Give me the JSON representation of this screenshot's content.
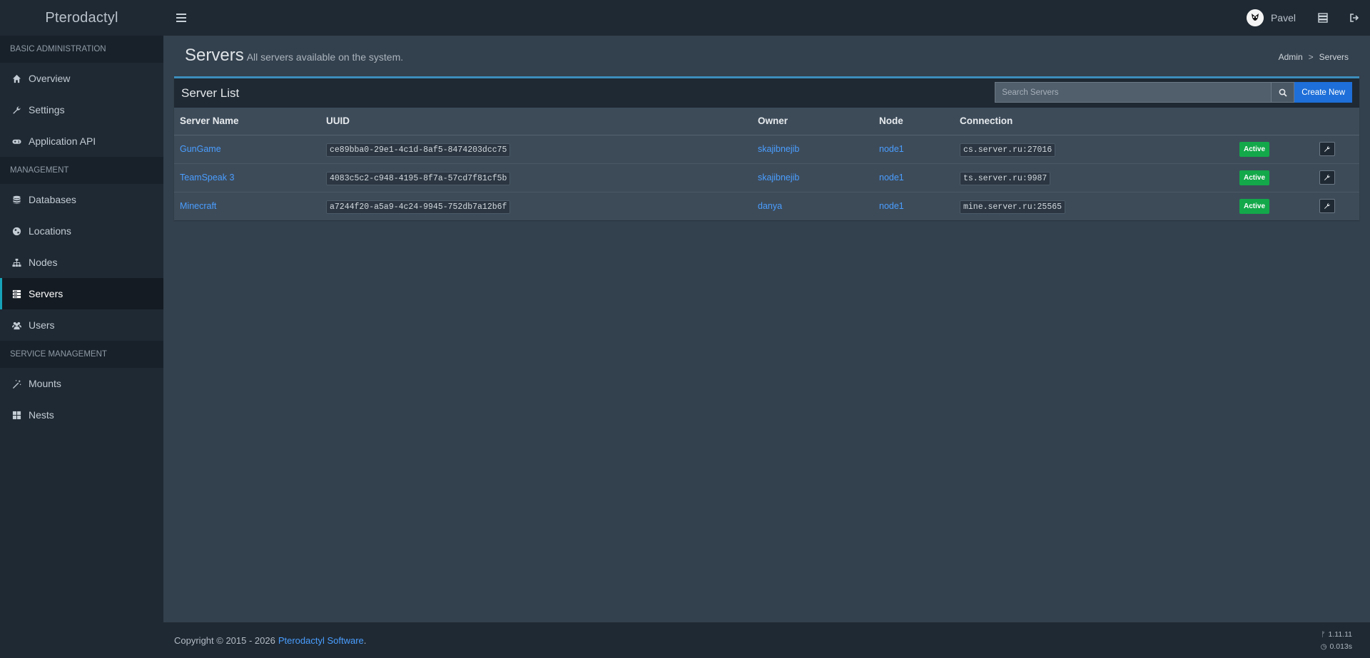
{
  "app": {
    "brand": "Pterodactyl"
  },
  "topbar": {
    "user_name": "Pavel"
  },
  "sidebar": {
    "sections": [
      {
        "header": "Basic Administration",
        "items": [
          {
            "label": "Overview",
            "icon": "home-icon"
          },
          {
            "label": "Settings",
            "icon": "wrench-icon"
          },
          {
            "label": "Application API",
            "icon": "gamepad-icon"
          }
        ]
      },
      {
        "header": "Management",
        "items": [
          {
            "label": "Databases",
            "icon": "database-icon"
          },
          {
            "label": "Locations",
            "icon": "globe-icon"
          },
          {
            "label": "Nodes",
            "icon": "sitemap-icon"
          },
          {
            "label": "Servers",
            "icon": "server-icon",
            "active": true
          },
          {
            "label": "Users",
            "icon": "users-icon"
          }
        ]
      },
      {
        "header": "Service Management",
        "items": [
          {
            "label": "Mounts",
            "icon": "magic-icon"
          },
          {
            "label": "Nests",
            "icon": "th-large-icon"
          }
        ]
      }
    ]
  },
  "page": {
    "title": "Servers",
    "subtitle": "All servers available on the system.",
    "breadcrumb": [
      "Admin",
      "Servers"
    ]
  },
  "server_list": {
    "title": "Server List",
    "search_placeholder": "Search Servers",
    "create_label": "Create New",
    "columns": [
      "Server Name",
      "UUID",
      "Owner",
      "Node",
      "Connection"
    ],
    "rows": [
      {
        "name": "GunGame",
        "uuid": "ce89bba0-29e1-4c1d-8af5-8474203dcc75",
        "owner": "skajibnejib",
        "node": "node1",
        "connection": "cs.server.ru:27016",
        "status": "Active"
      },
      {
        "name": "TeamSpeak 3",
        "uuid": "4083c5c2-c948-4195-8f7a-57cd7f81cf5b",
        "owner": "skajibnejib",
        "node": "node1",
        "connection": "ts.server.ru:9987",
        "status": "Active"
      },
      {
        "name": "Minecraft",
        "uuid": "a7244f20-a5a9-4c24-9945-752db7a12b6f",
        "owner": "danya",
        "node": "node1",
        "connection": "mine.server.ru:25565",
        "status": "Active"
      }
    ]
  },
  "footer": {
    "copyright": "Copyright © 2015 - 2026",
    "company": "Pterodactyl Software",
    "suffix": ".",
    "version": "1.11.11",
    "time": "0.013s"
  },
  "colors": {
    "accent": "#3c8dbc",
    "primary_button": "#1e6fd9",
    "status_active": "#13a84a",
    "active_marker": "#16a2b8"
  }
}
